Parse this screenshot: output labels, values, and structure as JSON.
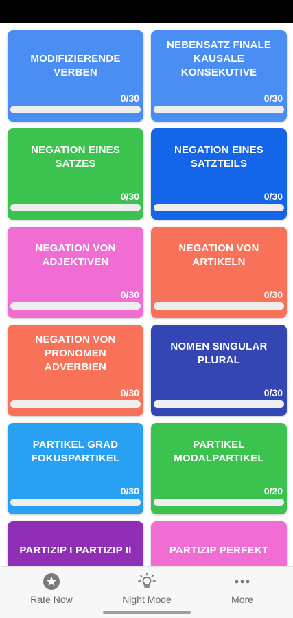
{
  "status_bar": {},
  "lessons": [
    {
      "title": "MODIFIZIERENDE VERBEN",
      "count": "0/30",
      "progress": 0,
      "color": "#4a8ef3"
    },
    {
      "title": "NEBENSATZ FINALE KAUSALE KONSEKUTIVE",
      "count": "0/30",
      "progress": 0,
      "color": "#4a8ef3"
    },
    {
      "title": "NEGATION EINES SATZES",
      "count": "0/30",
      "progress": 0,
      "color": "#3cc24f"
    },
    {
      "title": "NEGATION EINES SATZTEILS",
      "count": "0/30",
      "progress": 0,
      "color": "#1565e8"
    },
    {
      "title": "NEGATION VON ADJEKTIVEN",
      "count": "0/30",
      "progress": 0,
      "color": "#f06dd3"
    },
    {
      "title": "NEGATION VON ARTIKELN",
      "count": "0/30",
      "progress": 0,
      "color": "#f87159"
    },
    {
      "title": "NEGATION VON PRONOMEN ADVERBIEN",
      "count": "0/30",
      "progress": 0,
      "color": "#f87159"
    },
    {
      "title": "NOMEN SINGULAR PLURAL",
      "count": "0/30",
      "progress": 0,
      "color": "#3346b4"
    },
    {
      "title": "PARTIKEL GRAD FOKUSPARTIKEL",
      "count": "0/30",
      "progress": 0,
      "color": "#29a1f3"
    },
    {
      "title": "PARTIKEL MODALPARTIKEL",
      "count": "0/20",
      "progress": 0,
      "color": "#3cc24f"
    },
    {
      "title": "PARTIZIP I PARTIZIP II",
      "count": "",
      "progress": 0,
      "color": "#8e2fb5"
    },
    {
      "title": "PARTIZIP PERFEKT",
      "count": "",
      "progress": 0,
      "color": "#f06dd3"
    }
  ],
  "bottom_nav": {
    "rate_label": "Rate Now",
    "rate_icon": "star-circle-icon",
    "night_label": "Night Mode",
    "night_icon": "lightbulb-icon",
    "more_label": "More",
    "more_icon": "more-dots-icon"
  }
}
